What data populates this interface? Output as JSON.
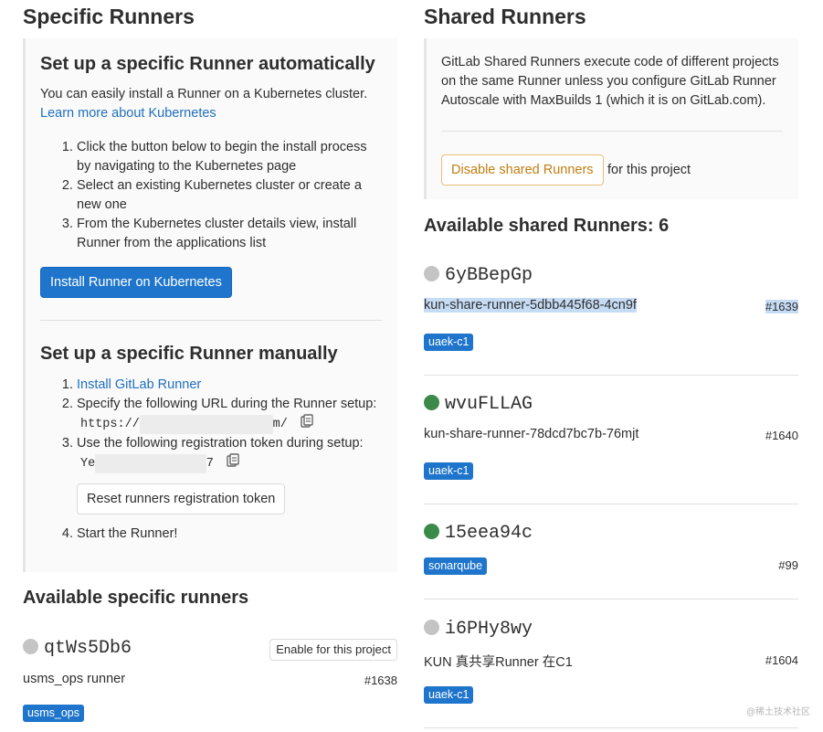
{
  "specific": {
    "title": "Specific Runners",
    "auto": {
      "heading": "Set up a specific Runner automatically",
      "intro": "You can easily install a Runner on a Kubernetes cluster.",
      "learn_link": "Learn more about Kubernetes",
      "steps": [
        "Click the button below to begin the install process by navigating to the Kubernetes page",
        "Select an existing Kubernetes cluster or create a new one",
        "From the Kubernetes cluster details view, install Runner from the applications list"
      ],
      "install_button": "Install Runner on Kubernetes"
    },
    "manual": {
      "heading": "Set up a specific Runner manually",
      "step1_link": "Install GitLab Runner",
      "step2_text": "Specify the following URL during the Runner setup:",
      "url_prefix": "https://",
      "url_suffix": "m/",
      "step3_text": "Use the following registration token during setup:",
      "token_prefix": "Ye",
      "token_suffix": "7",
      "reset_button": "Reset runners registration token",
      "step4_text": "Start the Runner!"
    },
    "available_title": "Available specific runners",
    "runners": [
      {
        "name": "qtWs5Db6",
        "status": "grey",
        "description": "usms_ops runner",
        "id": "#1638",
        "tag": "usms_ops",
        "enable_button": "Enable for this project"
      }
    ]
  },
  "shared": {
    "title": "Shared Runners",
    "info": "GitLab Shared Runners execute code of different projects on the same Runner unless you configure GitLab Runner Autoscale with MaxBuilds 1 (which it is on GitLab.com).",
    "disable_button": "Disable shared Runners",
    "disable_suffix": "for this project",
    "available_title": "Available shared Runners: 6",
    "runners": [
      {
        "name": "6yBBepGp",
        "status": "grey",
        "description": "kun-share-runner-5dbb445f68-4cn9f",
        "id": "#1639",
        "tag": "uaek-c1"
      },
      {
        "name": "wvuFLLAG",
        "status": "green",
        "description": "kun-share-runner-78dcd7bc7b-76mjt",
        "id": "#1640",
        "tag": "uaek-c1"
      },
      {
        "name": "15eea94c",
        "status": "green",
        "description": "",
        "id": "#99",
        "tag": "sonarqube"
      },
      {
        "name": "i6PHy8wy",
        "status": "grey",
        "description": "KUN 真共享Runner 在C1",
        "id": "#1604",
        "tag": "uaek-c1"
      }
    ]
  },
  "watermark": "@稀土技术社区",
  "colors": {
    "accent": "#1f75cb",
    "link": "#1f6fbf",
    "warning": "#c17d10",
    "status_online": "#3b8a4a",
    "status_idle": "#c4c4c4"
  }
}
